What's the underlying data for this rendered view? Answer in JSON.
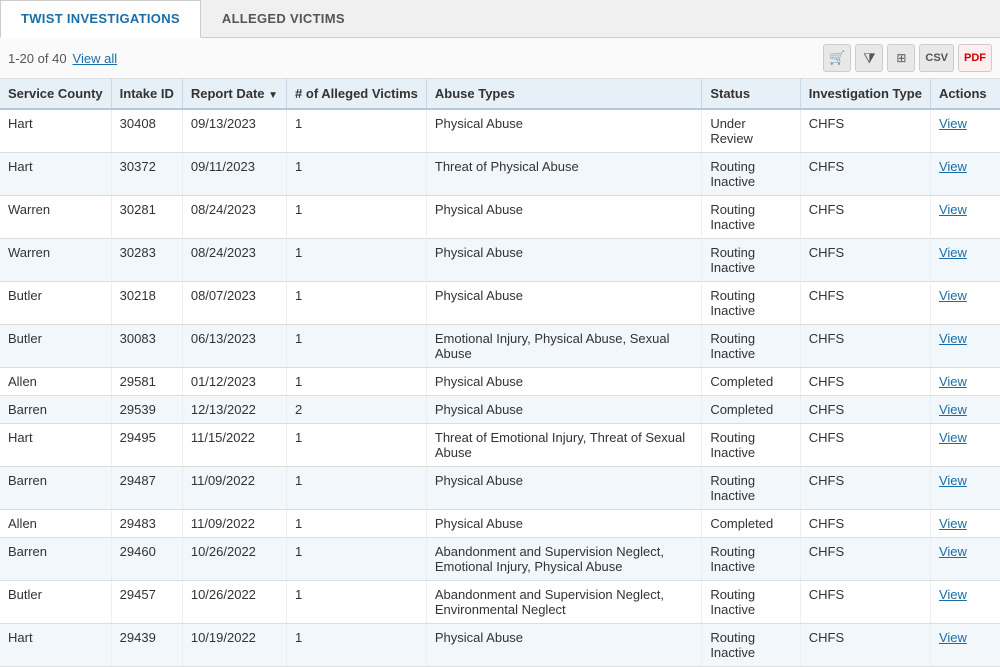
{
  "tabs": [
    {
      "id": "twist",
      "label": "TWIST INVESTIGATIONS",
      "active": true
    },
    {
      "id": "victims",
      "label": "ALLEGED VICTIMS",
      "active": false
    }
  ],
  "toolbar": {
    "range_text": "1-20 of 40",
    "view_all_label": "View all"
  },
  "toolbar_icons": [
    {
      "name": "cart-icon",
      "symbol": "🛒"
    },
    {
      "name": "filter-icon",
      "symbol": "▼"
    },
    {
      "name": "columns-icon",
      "symbol": "⊞"
    },
    {
      "name": "csv-icon",
      "symbol": "CSV"
    },
    {
      "name": "pdf-icon",
      "symbol": "PDF"
    }
  ],
  "table": {
    "columns": [
      {
        "id": "service_county",
        "label": "Service County",
        "sortable": false
      },
      {
        "id": "intake_id",
        "label": "Intake ID",
        "sortable": false
      },
      {
        "id": "report_date",
        "label": "Report Date",
        "sortable": true,
        "sort_dir": "desc"
      },
      {
        "id": "num_victims",
        "label": "# of Alleged Victims",
        "sortable": false
      },
      {
        "id": "abuse_types",
        "label": "Abuse Types",
        "sortable": false
      },
      {
        "id": "status",
        "label": "Status",
        "sortable": false
      },
      {
        "id": "inv_type",
        "label": "Investigation Type",
        "sortable": false
      },
      {
        "id": "actions",
        "label": "Actions",
        "sortable": false
      }
    ],
    "rows": [
      {
        "service_county": "Hart",
        "intake_id": "30408",
        "report_date": "09/13/2023",
        "num_victims": "1",
        "abuse_types": "Physical Abuse",
        "status": "Under Review",
        "inv_type": "CHFS",
        "action": "View"
      },
      {
        "service_county": "Hart",
        "intake_id": "30372",
        "report_date": "09/11/2023",
        "num_victims": "1",
        "abuse_types": "Threat of Physical Abuse",
        "status": "Routing Inactive",
        "inv_type": "CHFS",
        "action": "View"
      },
      {
        "service_county": "Warren",
        "intake_id": "30281",
        "report_date": "08/24/2023",
        "num_victims": "1",
        "abuse_types": "Physical Abuse",
        "status": "Routing Inactive",
        "inv_type": "CHFS",
        "action": "View"
      },
      {
        "service_county": "Warren",
        "intake_id": "30283",
        "report_date": "08/24/2023",
        "num_victims": "1",
        "abuse_types": "Physical Abuse",
        "status": "Routing Inactive",
        "inv_type": "CHFS",
        "action": "View"
      },
      {
        "service_county": "Butler",
        "intake_id": "30218",
        "report_date": "08/07/2023",
        "num_victims": "1",
        "abuse_types": "Physical Abuse",
        "status": "Routing Inactive",
        "inv_type": "CHFS",
        "action": "View"
      },
      {
        "service_county": "Butler",
        "intake_id": "30083",
        "report_date": "06/13/2023",
        "num_victims": "1",
        "abuse_types": "Emotional Injury, Physical Abuse, Sexual Abuse",
        "status": "Routing Inactive",
        "inv_type": "CHFS",
        "action": "View"
      },
      {
        "service_county": "Allen",
        "intake_id": "29581",
        "report_date": "01/12/2023",
        "num_victims": "1",
        "abuse_types": "Physical Abuse",
        "status": "Completed",
        "inv_type": "CHFS",
        "action": "View"
      },
      {
        "service_county": "Barren",
        "intake_id": "29539",
        "report_date": "12/13/2022",
        "num_victims": "2",
        "abuse_types": "Physical Abuse",
        "status": "Completed",
        "inv_type": "CHFS",
        "action": "View"
      },
      {
        "service_county": "Hart",
        "intake_id": "29495",
        "report_date": "11/15/2022",
        "num_victims": "1",
        "abuse_types": "Threat of Emotional Injury, Threat of Sexual Abuse",
        "status": "Routing Inactive",
        "inv_type": "CHFS",
        "action": "View"
      },
      {
        "service_county": "Barren",
        "intake_id": "29487",
        "report_date": "11/09/2022",
        "num_victims": "1",
        "abuse_types": "Physical Abuse",
        "status": "Routing Inactive",
        "inv_type": "CHFS",
        "action": "View"
      },
      {
        "service_county": "Allen",
        "intake_id": "29483",
        "report_date": "11/09/2022",
        "num_victims": "1",
        "abuse_types": "Physical Abuse",
        "status": "Completed",
        "inv_type": "CHFS",
        "action": "View"
      },
      {
        "service_county": "Barren",
        "intake_id": "29460",
        "report_date": "10/26/2022",
        "num_victims": "1",
        "abuse_types": "Abandonment and Supervision Neglect, Emotional Injury, Physical Abuse",
        "status": "Routing Inactive",
        "inv_type": "CHFS",
        "action": "View"
      },
      {
        "service_county": "Butler",
        "intake_id": "29457",
        "report_date": "10/26/2022",
        "num_victims": "1",
        "abuse_types": "Abandonment and Supervision Neglect, Environmental Neglect",
        "status": "Routing Inactive",
        "inv_type": "CHFS",
        "action": "View"
      },
      {
        "service_county": "Hart",
        "intake_id": "29439",
        "report_date": "10/19/2022",
        "num_victims": "1",
        "abuse_types": "Physical Abuse",
        "status": "Routing Inactive",
        "inv_type": "CHFS",
        "action": "View"
      }
    ]
  }
}
